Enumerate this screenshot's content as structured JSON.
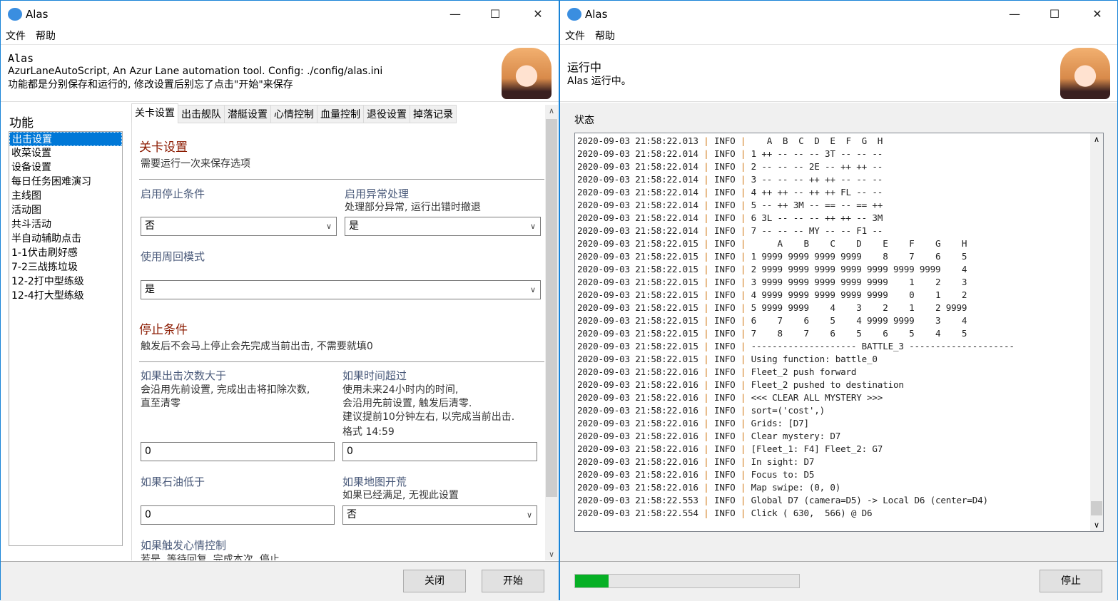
{
  "left_window": {
    "title": "Alas",
    "menu": [
      "文件",
      "帮助"
    ],
    "header": {
      "title": "Alas",
      "line1": "AzurLaneAutoScript, An Azur Lane automation tool. Config: ./config/alas.ini",
      "line2": "功能都是分别保存和运行的, 修改设置后别忘了点击\"开始\"来保存"
    },
    "sidebar_title": "功能",
    "sidebar_items": [
      "出击设置",
      "收菜设置",
      "设备设置",
      "每日任务困难演习",
      "主线图",
      "活动图",
      "共斗活动",
      "半自动辅助点击",
      "1-1伏击刷好感",
      "7-2三战拣垃圾",
      "12-2打中型练级",
      "12-4打大型练级"
    ],
    "tabs": [
      "关卡设置",
      "出击舰队",
      "潜艇设置",
      "心情控制",
      "血量控制",
      "退役设置",
      "掉落记录"
    ],
    "form": {
      "section1_title": "关卡设置",
      "section1_desc": "需要运行一次来保存选项",
      "enable_stop_label": "启用停止条件",
      "enable_stop_value": "否",
      "enable_exception_label": "启用异常处理",
      "enable_exception_desc": "处理部分异常, 运行出错时撤退",
      "enable_exception_value": "是",
      "loop_mode_label": "使用周回模式",
      "loop_mode_value": "是",
      "section2_title": "停止条件",
      "section2_desc": "触发后不会马上停止会先完成当前出击, 不需要就填0",
      "sortie_count_label": "如果出击次数大于",
      "sortie_count_desc1": "会沿用先前设置, 完成出击将扣除次数,",
      "sortie_count_desc2": "直至清零",
      "sortie_count_value": "0",
      "time_label": "如果时间超过",
      "time_desc1": "使用未来24小时内的时间,",
      "time_desc2": "会沿用先前设置, 触发后清零.",
      "time_desc3": "建议提前10分钟左右, 以完成当前出击.",
      "time_desc4": "格式 14:59",
      "time_value": "0",
      "oil_label": "如果石油低于",
      "oil_value": "0",
      "map_clear_label": "如果地图开荒",
      "map_clear_desc": "如果已经满足, 无视此设置",
      "map_clear_value": "否",
      "emotion_label": "如果触发心情控制",
      "emotion_desc": "若是, 等待回复, 完成本次, 停止"
    },
    "buttons": {
      "close": "关闭",
      "start": "开始"
    }
  },
  "right_window": {
    "title": "Alas",
    "menu": [
      "文件",
      "帮助"
    ],
    "header": {
      "title": "运行中",
      "subtitle": "Alas 运行中。"
    },
    "status_label": "状态",
    "log": [
      [
        "2020-09-03 21:58:22.013",
        "INFO",
        "   A  B  C  D  E  F  G  H"
      ],
      [
        "2020-09-03 21:58:22.014",
        "INFO",
        "1 ++ -- -- -- 3T -- -- --"
      ],
      [
        "2020-09-03 21:58:22.014",
        "INFO",
        "2 -- -- -- 2E -- ++ ++ --"
      ],
      [
        "2020-09-03 21:58:22.014",
        "INFO",
        "3 -- -- -- ++ ++ -- -- --"
      ],
      [
        "2020-09-03 21:58:22.014",
        "INFO",
        "4 ++ ++ -- ++ ++ FL -- --"
      ],
      [
        "2020-09-03 21:58:22.014",
        "INFO",
        "5 -- ++ 3M -- == -- == ++"
      ],
      [
        "2020-09-03 21:58:22.014",
        "INFO",
        "6 3L -- -- -- ++ ++ -- 3M"
      ],
      [
        "2020-09-03 21:58:22.014",
        "INFO",
        "7 -- -- -- MY -- -- F1 --"
      ],
      [
        "2020-09-03 21:58:22.015",
        "INFO",
        "     A    B    C    D    E    F    G    H"
      ],
      [
        "2020-09-03 21:58:22.015",
        "INFO",
        "1 9999 9999 9999 9999    8    7    6    5"
      ],
      [
        "2020-09-03 21:58:22.015",
        "INFO",
        "2 9999 9999 9999 9999 9999 9999 9999    4"
      ],
      [
        "2020-09-03 21:58:22.015",
        "INFO",
        "3 9999 9999 9999 9999 9999    1    2    3"
      ],
      [
        "2020-09-03 21:58:22.015",
        "INFO",
        "4 9999 9999 9999 9999 9999    0    1    2"
      ],
      [
        "2020-09-03 21:58:22.015",
        "INFO",
        "5 9999 9999    4    3    2    1    2 9999"
      ],
      [
        "2020-09-03 21:58:22.015",
        "INFO",
        "6    7    6    5    4 9999 9999    3    4"
      ],
      [
        "2020-09-03 21:58:22.015",
        "INFO",
        "7    8    7    6    5    6    5    4    5"
      ],
      [
        "2020-09-03 21:58:22.015",
        "INFO",
        "-------------------- BATTLE_3 --------------------"
      ],
      [
        "2020-09-03 21:58:22.015",
        "INFO",
        "Using function: battle_0"
      ],
      [
        "2020-09-03 21:58:22.016",
        "INFO",
        "Fleet_2 push forward"
      ],
      [
        "2020-09-03 21:58:22.016",
        "INFO",
        "Fleet_2 pushed to destination"
      ],
      [
        "2020-09-03 21:58:22.016",
        "INFO",
        "<<< CLEAR ALL MYSTERY >>>"
      ],
      [
        "2020-09-03 21:58:22.016",
        "INFO",
        "sort=('cost',)"
      ],
      [
        "2020-09-03 21:58:22.016",
        "INFO",
        "Grids: [D7]"
      ],
      [
        "2020-09-03 21:58:22.016",
        "INFO",
        "Clear mystery: D7"
      ],
      [
        "2020-09-03 21:58:22.016",
        "INFO",
        "[Fleet_1: F4] Fleet_2: G7"
      ],
      [
        "2020-09-03 21:58:22.016",
        "INFO",
        "In sight: D7"
      ],
      [
        "2020-09-03 21:58:22.016",
        "INFO",
        "Focus to: D5"
      ],
      [
        "2020-09-03 21:58:22.016",
        "INFO",
        "Map swipe: (0, 0)"
      ],
      [
        "2020-09-03 21:58:22.553",
        "INFO",
        "Global D7 (camera=D5) -> Local D6 (center=D4)"
      ],
      [
        "2020-09-03 21:58:22.554",
        "INFO",
        "Click ( 630,  566) @ D6"
      ]
    ],
    "progress_percent": 15,
    "progress_color": "#06b025",
    "buttons": {
      "stop": "停止"
    }
  }
}
